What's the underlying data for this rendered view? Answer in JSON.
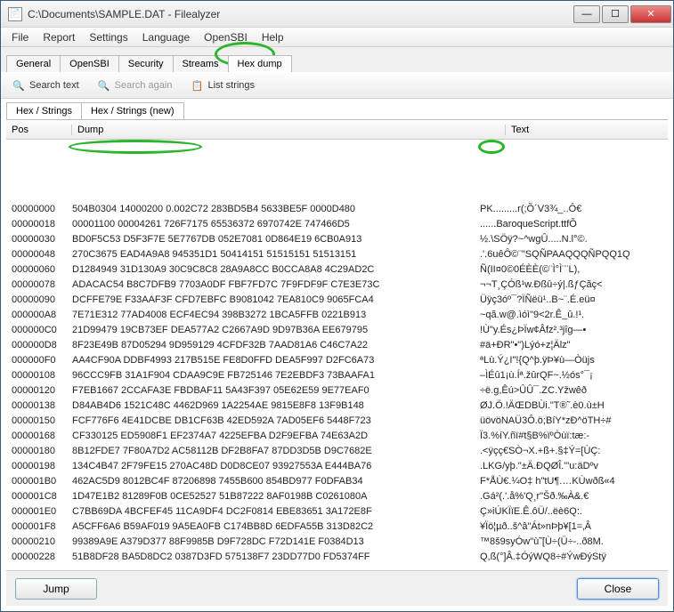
{
  "window": {
    "title": "C:\\Documents\\SAMPLE.DAT - Filealyzer"
  },
  "menu": [
    "File",
    "Report",
    "Settings",
    "Language",
    "OpenSBI",
    "Help"
  ],
  "tabs": [
    "General",
    "OpenSBI",
    "Security",
    "Streams",
    "Hex dump"
  ],
  "active_tab": 4,
  "toolbar": {
    "search_text": "Search text",
    "search_again": "Search again",
    "list_strings": "List strings"
  },
  "subtabs": [
    "Hex / Strings",
    "Hex / Strings (new)"
  ],
  "active_subtab": 0,
  "columns": {
    "pos": "Pos",
    "dump": "Dump",
    "text": "Text"
  },
  "rows": [
    {
      "pos": "00000000",
      "dump": "504B0304 14000200 0.002C72 283BD5B4 5633BE5F 0000D480",
      "text": "PK.........r(;Õ´V3¾_..Ô€"
    },
    {
      "pos": "00000018",
      "dump": "00001100 00004261 726F7175 65536372 6970742E 747466D5",
      "text": "......BaroqueScript.ttfÕ"
    },
    {
      "pos": "00000030",
      "dump": "BD0F5C53 D5F3F7E 5E7767DB 052E7081 0D864E19 6CB0A913",
      "text": "½.\\SÖÿ?~^wgÛ.....N.l°©."
    },
    {
      "pos": "00000048",
      "dump": "270C3675 EAD4A9A8 945351D1 50414151 51515151 51513151",
      "text": ".'.6uêÔ©¨\"SQÑPAAQQQÑPQQ1Q"
    },
    {
      "pos": "00000060",
      "dump": "D1284949 31D130A9 30C9C8C8 28A9A8CC B0CCA8A8 4C29AD2C",
      "text": "Ñ(II¤0©0ÉÈÈ(©¨Ì°Ì¨¨L)­,"
    },
    {
      "pos": "00000078",
      "dump": "ADACAC54 B8C7DFB9 7703A0DF FBF7FD7C 7F9FDF9F C7E3E73C",
      "text": "­¬¬T¸ÇÓß¹w.­Ðßû÷ý|.ßƒÇãç<"
    },
    {
      "pos": "00000090",
      "dump": "DCFFE79E F33AAF3F CFD7EBFC B9081042 7EA810C9 9065FCA4",
      "text": "Üÿç3óº¯?ÏÑëü¹..B~¨.É.eü¤"
    },
    {
      "pos": "000000A8",
      "dump": "7E71E312 77AD4008 ECF4EC94 398B3272 1BCA5FFB 0221B913",
      "text": "~qã.w­@.ìóì\"9<2r.Ê_û.!¹."
    },
    {
      "pos": "000000C0",
      "dump": "21D99479 19CB73EF DEA577A2 C2667A9D 9D97B36A EE679795",
      "text": "!Ù\"y.És¿ÞÏw¢Âfz².³jîg—•"
    },
    {
      "pos": "000000D8",
      "dump": "8F23E49B 87D05294 9D959129 4CFDF32B 7AAD81A6 C46C7A22",
      "text": "#ä+ÐR\"•\")Lýó+z­¦Älz\""
    },
    {
      "pos": "000000F0",
      "dump": "AA4CF90A DDBF4993 217B515E FE8D0FFD DEA5F997 D2FC6A73",
      "text": "ªLù.Ý¿I\"!{Q^þ.ÿÞ¥ù—Òüjs"
    },
    {
      "pos": "00000108",
      "dump": "96CCC9FB 31A1F904 CDAA9C9E FB725146 7E2EBDF3 73BAAFA1",
      "text": "–ÌÉû1¡ù.Íª.žûrQF~.½ós°¯¡"
    },
    {
      "pos": "00000120",
      "dump": "F7EB1667 2CCAFA3E FBDBAF11 5A43F397 05E62E59 9E77EAF0",
      "text": "÷ë.g,Êú>ÛÛ¯.ZC󗵿.Yžwêð"
    },
    {
      "pos": "00000138",
      "dump": "D84AB4D6 1521C48C 4462D969 1A2254AE 9815E8F8 13F9B148",
      "text": "ØJ.Ö.!ÄŒDBÙi.\"T®˜.è0.ù±H"
    },
    {
      "pos": "00000150",
      "dump": "FCF776F6 4E41DCBE DB1CF63B 42ED592A 7AD05EF6 5448F723",
      "text": "üövöNAÜ3Ô.ö;BíY*zÐ^öTH÷#"
    },
    {
      "pos": "00000168",
      "dump": "CF330125 ED5908F1 EF2374A7 4225EFBA D2F9EFBA 74E63A2D",
      "text": "Ï3.%íY.ñï#t§B%ïºÒùï:tæ:-"
    },
    {
      "pos": "00000180",
      "dump": "8B12FDE7 7F80A7D2 AC58112B DF2B8FA7 87DD3D5B D9C7682E",
      "text": ".<ÿçç€SÒ¬X.+ß+.§‡Ý=[ÙÇ:"
    },
    {
      "pos": "00000198",
      "dump": "134C4B47 2F79FE15 270AC48D D0D8CE07 93927553A E444BA76",
      "text": ".LKG/yþ.\"±Ä.ÐQØÎ.\"'u:äDºv"
    },
    {
      "pos": "000001B0",
      "dump": "462AC5D9 8012BC4F 87206898 7455B600 854BD977 F0DFAB34",
      "text": "F*ÅÙ€.¼O‡ h\"tU¶.…KÙwðß«4"
    },
    {
      "pos": "000001C8",
      "dump": "1D47E1B2 81289F0B 0CE52527 51B87222 8AF0198B C0261080A",
      "text": ".Gá²(.'.å%'Q¸r\"Šð.‰À&.€"
    },
    {
      "pos": "000001E0",
      "dump": "C7BB69DA 4BCFEF45 11CA9DF4 DC2F0814 EBE83651 3A172E8F",
      "text": "Ç»iÚKÏïE.Ê.ôÜ/..ëè6Q:."
    },
    {
      "pos": "000001F8",
      "dump": "A5CFF6A6 B59AF019 9A5EA0FB C174BB8D 6EDFA55B 313D82C2",
      "text": "¥Ïö¦µð..š^â\"Át»nÞþ¥[1=‚Â"
    },
    {
      "pos": "00000210",
      "dump": "99389A9E A379D377 88F9985B D9F728DC F72D141E F0384D13",
      "text": "™8š9syÓw\"ù˜[Ù÷(Ü÷-..ð8M."
    },
    {
      "pos": "00000228",
      "dump": "51B8DF28 BA5D8DC2 0387D3FD 575138F7 23DD77D0 FD5374FF",
      "text": "Q,ß(°]Â.‡ÓýWQ8÷#ÝwÐýStÿ"
    }
  ],
  "buttons": {
    "jump": "Jump",
    "close": "Close"
  }
}
